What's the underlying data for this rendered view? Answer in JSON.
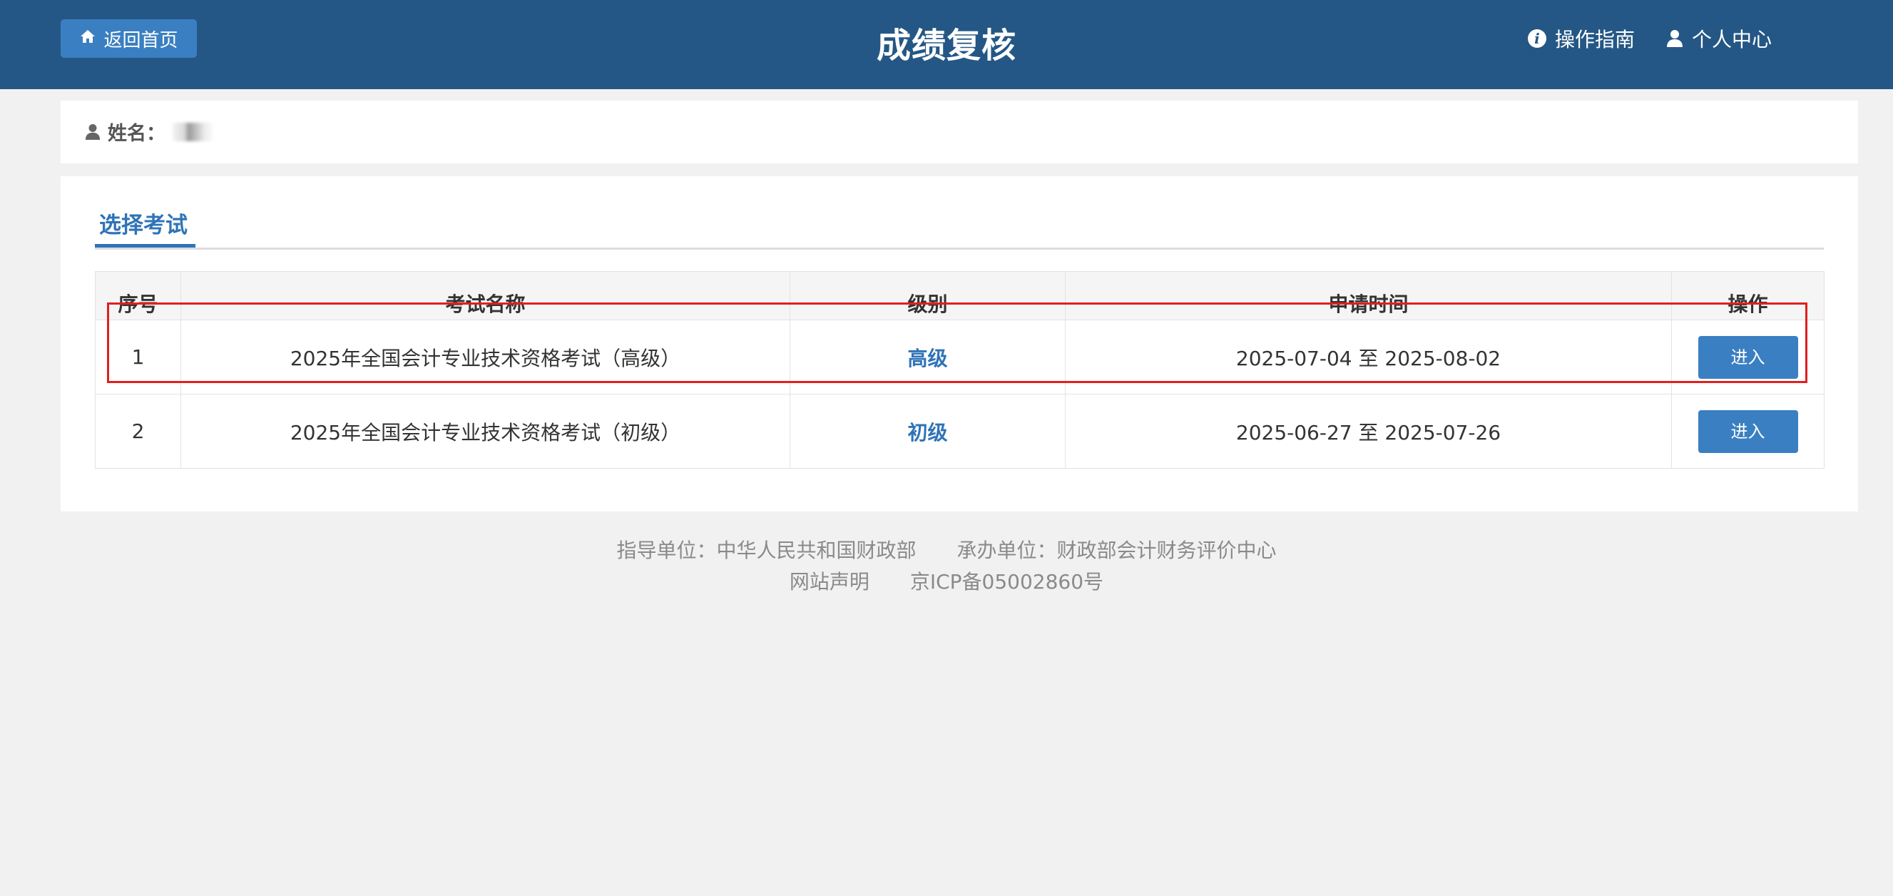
{
  "header": {
    "home_button_label": "返回首页",
    "title": "成绩复核",
    "guide_label": "操作指南",
    "guide_icon": "info-icon",
    "personal_center_label": "个人中心",
    "personal_center_icon": "user-icon",
    "background_color": "#245785"
  },
  "user_info": {
    "name_label": "姓名："
  },
  "main": {
    "tab_label": "选择考试",
    "table": {
      "headers": [
        "序号",
        "考试名称",
        "级别",
        "申请时间",
        "操作"
      ],
      "rows": [
        {
          "index": "1",
          "exam_name": "2025年全国会计专业技术资格考试（高级）",
          "level": "高级",
          "apply_time": "2025-07-04 至 2025-08-02",
          "action": "进入"
        },
        {
          "index": "2",
          "exam_name": "2025年全国会计专业技术资格考试（初级）",
          "level": "初级",
          "apply_time": "2025-06-27 至 2025-07-26",
          "action": "进入"
        }
      ]
    }
  },
  "footer": {
    "guide_unit": "指导单位：中华人民共和国财政部",
    "host_unit": "承办单位：财政部会计财务评价中心",
    "statement": "网站声明",
    "icp": "京ICP备05002860号"
  },
  "colors": {
    "accent": "#2f73b7",
    "button": "#3a7fc1",
    "highlight": "#e0201f"
  }
}
